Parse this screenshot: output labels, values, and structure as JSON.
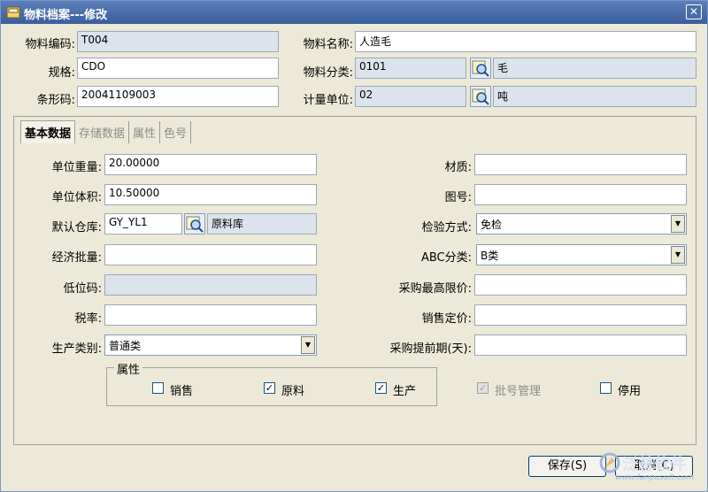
{
  "window": {
    "title": "物料档案---修改",
    "close_glyph": "✕"
  },
  "header": {
    "code_label": "物料编码:",
    "code_value": "T004",
    "name_label": "物料名称:",
    "name_value": "人造毛",
    "spec_label": "规格:",
    "spec_value": "CDO",
    "category_label": "物料分类:",
    "category_code": "0101",
    "category_name": "毛",
    "barcode_label": "条形码:",
    "barcode_value": "20041109003",
    "unit_label": "计量单位:",
    "unit_code": "02",
    "unit_name": "吨"
  },
  "tabs": [
    {
      "label": "基本数据",
      "active": true
    },
    {
      "label": "存储数据",
      "active": false
    },
    {
      "label": "属性",
      "active": false
    },
    {
      "label": "色号",
      "active": false
    }
  ],
  "basic": {
    "unit_weight_label": "单位重量:",
    "unit_weight": "20.00000",
    "unit_volume_label": "单位体积:",
    "unit_volume": "10.50000",
    "default_wh_label": "默认仓库:",
    "default_wh_code": "GY_YL1",
    "default_wh_name": "原料库",
    "eco_batch_label": "经济批量:",
    "eco_batch": "",
    "low_code_label": "低位码:",
    "low_code": "",
    "tax_label": "税率:",
    "tax": "",
    "prod_type_label": "生产类别:",
    "prod_type": "普通类",
    "material_label": "材质:",
    "material": "",
    "drawing_label": "图号:",
    "drawing": "",
    "inspect_label": "检验方式:",
    "inspect": "免检",
    "abc_label": "ABC分类:",
    "abc": "B类",
    "max_price_label": "采购最高限价:",
    "max_price": "",
    "sale_price_label": "销售定价:",
    "sale_price": "",
    "lead_time_label": "采购提前期(天):",
    "lead_time": ""
  },
  "attributes": {
    "title": "属性",
    "sale_label": "销售",
    "sale_checked": false,
    "raw_label": "原料",
    "raw_checked": true,
    "prod_label": "生产",
    "prod_checked": true,
    "batch_label": "批号管理",
    "batch_checked": true,
    "disable_label": "停用",
    "disable_checked": false
  },
  "buttons": {
    "save": "保存(S)",
    "cancel": "取消(C)"
  },
  "watermark": {
    "brand": "泛普软件",
    "url": "www.fanpusoft.com"
  },
  "colors": {
    "title_bar": "#3A5E9C",
    "readonly_field": "#DDE3EC",
    "window_bg": "#ECE9D8"
  },
  "icons": {
    "window": "cabinet-icon",
    "lookup": "lookup-search-icon",
    "close": "close-icon",
    "dropdown": "dropdown-arrow-icon"
  }
}
